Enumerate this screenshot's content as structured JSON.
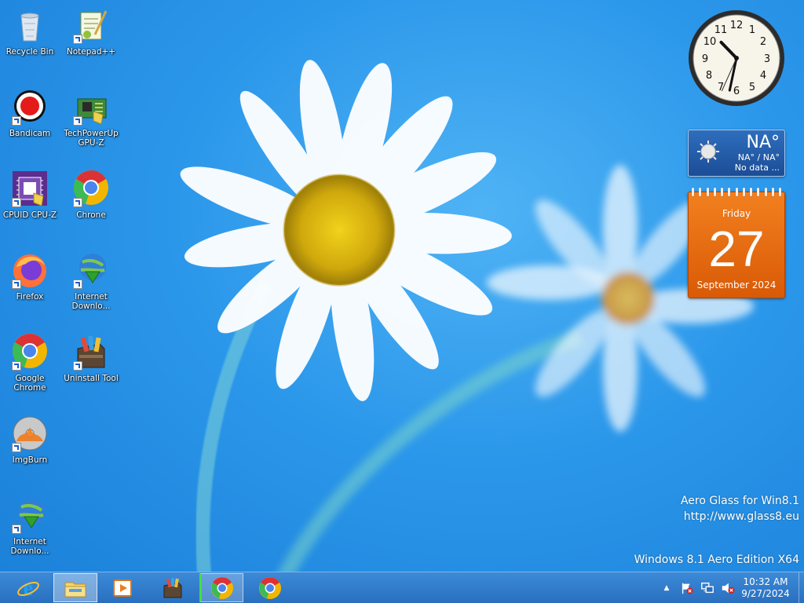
{
  "desktop": {
    "icons": [
      {
        "label": "Recycle Bin",
        "icon": "recycle-bin-icon"
      },
      {
        "label": "Notepad++",
        "icon": "notepad-plus-plus-icon"
      },
      {
        "label": "Bandicam",
        "icon": "bandicam-icon"
      },
      {
        "label": "TechPowerUp GPU-Z",
        "icon": "gpu-z-icon"
      },
      {
        "label": "CPUID CPU-Z",
        "icon": "cpu-z-icon"
      },
      {
        "label": "Chrone",
        "icon": "chrome-icon"
      },
      {
        "label": "Firefox",
        "icon": "firefox-icon"
      },
      {
        "label": "Internet Downlo...",
        "icon": "internet-download-manager-icon"
      },
      {
        "label": "Google Chrome",
        "icon": "chrome-icon"
      },
      {
        "label": "Uninstall Tool",
        "icon": "uninstall-tool-icon"
      },
      {
        "label": "ImgBurn",
        "icon": "imgburn-icon"
      },
      {
        "label": "Internet Downlo...",
        "icon": "internet-download-manager-icon"
      }
    ]
  },
  "gadgets": {
    "clock": {
      "hour": 10,
      "minute": 32,
      "second": 34
    },
    "weather": {
      "temp": "NA°",
      "range": "NA° / NA°",
      "status": "No data ..."
    },
    "calendar": {
      "weekday": "Friday",
      "day": "27",
      "month_year": "September 2024"
    }
  },
  "watermark": {
    "line1": "Aero Glass for Win8.1",
    "line2": "http://www.glass8.eu",
    "edition": "Windows 8.1 Aero Edition X64"
  },
  "taskbar": {
    "buttons": [
      {
        "icon": "internet-explorer-icon",
        "state": "normal"
      },
      {
        "icon": "file-explorer-icon",
        "state": "active"
      },
      {
        "icon": "media-player-icon",
        "state": "normal"
      },
      {
        "icon": "uninstall-tool-icon",
        "state": "normal"
      },
      {
        "icon": "chrome-icon",
        "state": "highlight"
      },
      {
        "icon": "chrome-icon",
        "state": "normal"
      }
    ],
    "tray": {
      "overflow_glyph": "▲",
      "icons": [
        "action-center-flag-icon",
        "network-icon",
        "volume-muted-icon"
      ],
      "time": "10:32 AM",
      "date": "9/27/2024"
    }
  },
  "colors": {
    "accent": "#2a6fbf",
    "calendar": "#e86a12",
    "weather": "#2458a6"
  }
}
